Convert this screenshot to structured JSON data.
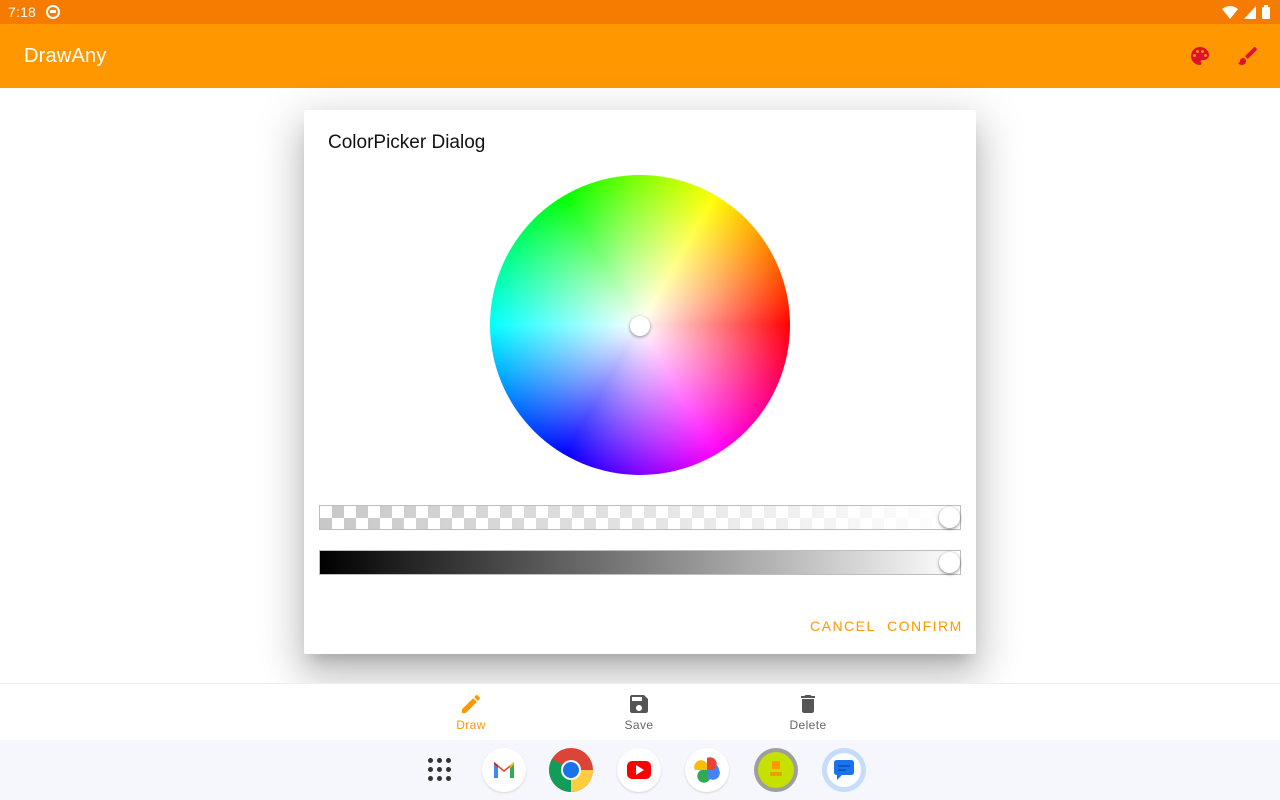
{
  "status_bar": {
    "time": "7:18"
  },
  "app_bar": {
    "title": "DrawAny",
    "palette_icon": "palette-icon",
    "brush_icon": "brush-icon",
    "icon_color": "#e0102d"
  },
  "dialog": {
    "title": "ColorPicker Dialog",
    "cancel_label": "CANCEL",
    "confirm_label": "CONFIRM",
    "alpha_value": 1.0,
    "brightness_value": 1.0
  },
  "bottom_nav": {
    "items": [
      {
        "label": "Draw",
        "icon": "pencil-icon",
        "active": true
      },
      {
        "label": "Save",
        "icon": "save-icon",
        "active": false
      },
      {
        "label": "Delete",
        "icon": "trash-icon",
        "active": false
      }
    ]
  },
  "taskbar": {
    "apps": [
      "apps-grid-icon",
      "gmail-icon",
      "chrome-icon",
      "youtube-icon",
      "photos-icon",
      "drawany-icon",
      "messages-icon"
    ]
  },
  "colors": {
    "status_bar": "#f57c00",
    "app_bar": "#ff9800",
    "accent": "#ff9800"
  }
}
